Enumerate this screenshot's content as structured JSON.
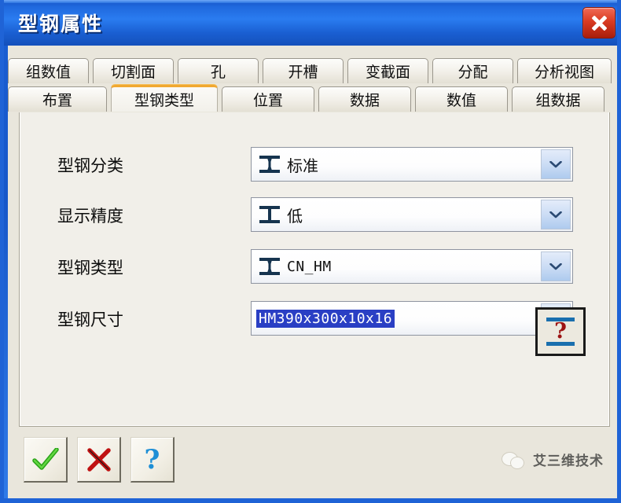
{
  "window": {
    "title": "型钢属性",
    "close_icon": "close-icon"
  },
  "tabs": {
    "row1": [
      {
        "label": "组数值",
        "active": false
      },
      {
        "label": "切割面",
        "active": false
      },
      {
        "label": "孔",
        "active": false
      },
      {
        "label": "开槽",
        "active": false
      },
      {
        "label": "变截面",
        "active": false
      },
      {
        "label": "分配",
        "active": false
      },
      {
        "label": "分析视图",
        "active": false
      }
    ],
    "row2": [
      {
        "label": "布置",
        "active": false
      },
      {
        "label": "型钢类型",
        "active": true
      },
      {
        "label": "位置",
        "active": false
      },
      {
        "label": "数据",
        "active": false
      },
      {
        "label": "数值",
        "active": false
      },
      {
        "label": "组数据",
        "active": false
      }
    ]
  },
  "form": {
    "rows": [
      {
        "label": "型钢分类",
        "value": "标准",
        "icon": "i-beam-icon",
        "selected": false,
        "mono": false
      },
      {
        "label": "显示精度",
        "value": "低",
        "icon": "i-beam-icon",
        "selected": false,
        "mono": false
      },
      {
        "label": "型钢类型",
        "value": "CN_HM",
        "icon": "i-beam-icon",
        "selected": false,
        "mono": true
      },
      {
        "label": "型钢尺寸",
        "value": "HM390x300x10x16",
        "icon": "none",
        "selected": true,
        "mono": true
      }
    ],
    "profile_button": {
      "name": "profile-question-button",
      "glyph": "?"
    }
  },
  "footer": {
    "ok_label": "✔",
    "cancel_label": "✘",
    "help_label": "?",
    "watermark_text": "艾三维技术"
  },
  "colors": {
    "titlebar_blue": "#1f68dd",
    "close_red": "#d93b22",
    "active_tab_orange": "#f0a830",
    "selection_blue": "#2a3fc4",
    "panel_bg": "#f1efe9",
    "client_bg": "#e9e6dc",
    "ibeam_navy": "#16344f"
  }
}
